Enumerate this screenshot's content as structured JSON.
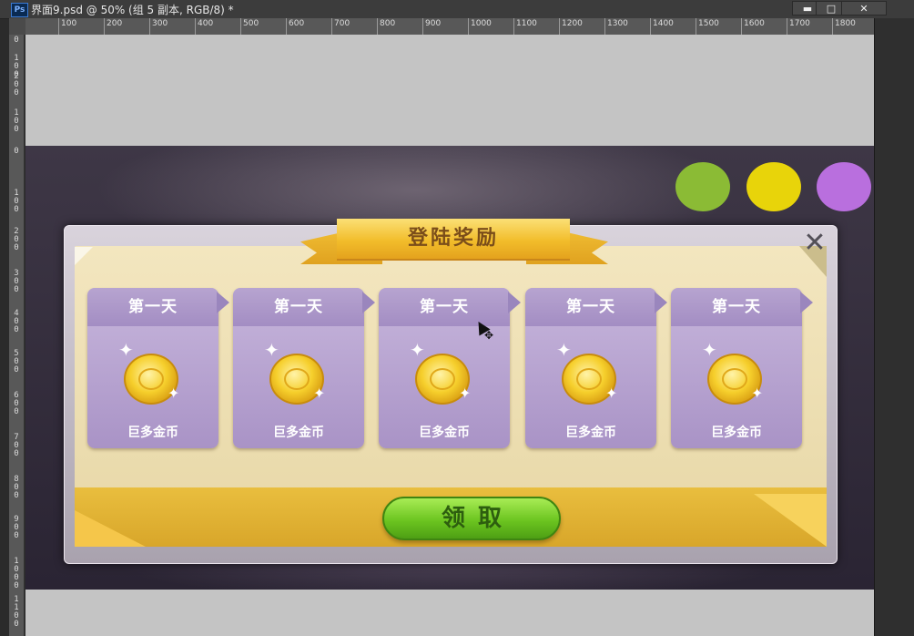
{
  "window": {
    "app_badge": "Ps",
    "doc_title": "界面9.psd @ 50% (组 5 副本, RGB/8) *",
    "minimize": "▬",
    "restore": "□",
    "close": "✕"
  },
  "ruler_top": [
    "100",
    "200",
    "300",
    "400",
    "500",
    "600",
    "700",
    "800",
    "900",
    "1000",
    "1100",
    "1200",
    "1300",
    "1400",
    "1500",
    "1600",
    "1700",
    "1800"
  ],
  "ruler_left": [
    "0",
    "1\n0\n0",
    "2\n0\n0",
    "1\n0\n0",
    "0",
    "1\n0\n0",
    "2\n0\n0",
    "3\n0\n0",
    "4\n0\n0",
    "5\n0\n0",
    "6\n0\n0",
    "7\n0\n0",
    "8\n0\n0",
    "9\n0\n0",
    "1\n0\n0\n0",
    "1\n1\n0\n0"
  ],
  "swatches": [
    "#8bbb35",
    "#e8d40a",
    "#b96fde"
  ],
  "dialog": {
    "title": "登陆奖励",
    "close_glyph": "✕",
    "cards": [
      {
        "day": "第一天",
        "reward": "巨多金币"
      },
      {
        "day": "第一天",
        "reward": "巨多金币"
      },
      {
        "day": "第一天",
        "reward": "巨多金币"
      },
      {
        "day": "第一天",
        "reward": "巨多金币"
      },
      {
        "day": "第一天",
        "reward": "巨多金币"
      }
    ],
    "claim_button": "领取"
  },
  "icons": {
    "coin": "coin-icon",
    "sparkle": "sparkle-icon",
    "cursor_move": "✥"
  }
}
